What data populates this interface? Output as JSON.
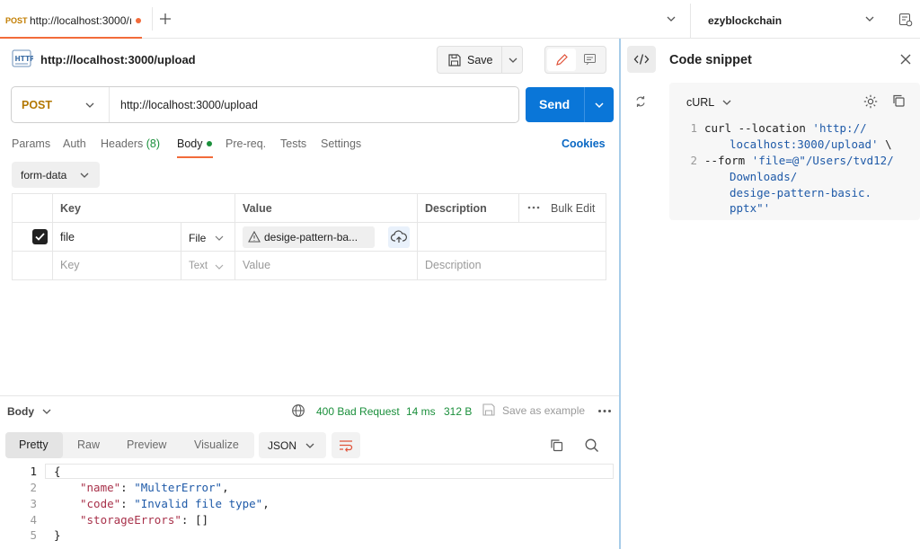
{
  "tabbar": {
    "tab_method": "POST",
    "tab_title": "http://localhost:3000/ı",
    "workspace": "ezyblockchain"
  },
  "request": {
    "title": "http://localhost:3000/upload",
    "save_label": "Save",
    "method": "POST",
    "url": "http://localhost:3000/upload",
    "send_label": "Send"
  },
  "request_tabs": {
    "params": "Params",
    "auth": "Auth",
    "headers": "Headers",
    "headers_count": "(8)",
    "body": "Body",
    "prereq": "Pre-req.",
    "tests": "Tests",
    "settings": "Settings",
    "cookies": "Cookies"
  },
  "body_mode": "form-data",
  "form_table": {
    "headers": {
      "key": "Key",
      "value": "Value",
      "description": "Description",
      "bulk_edit": "Bulk Edit"
    },
    "row": {
      "checked": true,
      "key": "file",
      "type": "File",
      "value": "desige-pattern-ba..."
    },
    "placeholder": {
      "key": "Key",
      "type": "Text",
      "value": "Value",
      "description": "Description"
    }
  },
  "snippet": {
    "title": "Code snippet",
    "language": "cURL",
    "lines": [
      {
        "num": "1",
        "cmd": "curl --location ",
        "str": "'http://",
        "tail": ""
      },
      {
        "num": "",
        "cmd": "",
        "str": "localhost:3000/upload'",
        "tail": " \\"
      },
      {
        "num": "2",
        "cmd": "--form ",
        "str": "'file=@\"/Users/tvd12/",
        "tail": ""
      },
      {
        "num": "",
        "cmd": "",
        "str": "Downloads/",
        "tail": ""
      },
      {
        "num": "",
        "cmd": "",
        "str": "desige-pattern-basic.",
        "tail": ""
      },
      {
        "num": "",
        "cmd": "",
        "str": "pptx\"'",
        "tail": ""
      }
    ]
  },
  "response": {
    "label": "Body",
    "status": "400 Bad Request",
    "time": "14 ms",
    "size": "312 B",
    "save_example": "Save as example",
    "tabs": {
      "pretty": "Pretty",
      "raw": "Raw",
      "preview": "Preview",
      "visualize": "Visualize"
    },
    "format": "JSON",
    "lines": [
      {
        "num": "1",
        "key": "",
        "colon": "",
        "val": "",
        "text": "{"
      },
      {
        "num": "2",
        "key": "\"name\"",
        "colon": ": ",
        "val": "\"MulterError\"",
        "text": ","
      },
      {
        "num": "3",
        "key": "\"code\"",
        "colon": ": ",
        "val": "\"Invalid file type\"",
        "text": ","
      },
      {
        "num": "4",
        "key": "\"storageErrors\"",
        "colon": ": ",
        "val": "",
        "text": "[]"
      },
      {
        "num": "5",
        "key": "",
        "colon": "",
        "val": "",
        "text": "}"
      }
    ]
  },
  "colors": {
    "accent": "#f26b3a",
    "send": "#0a76d8",
    "status_ok": "#1a8f3b",
    "json_key": "#a8314a",
    "json_string": "#1f5aa8"
  }
}
